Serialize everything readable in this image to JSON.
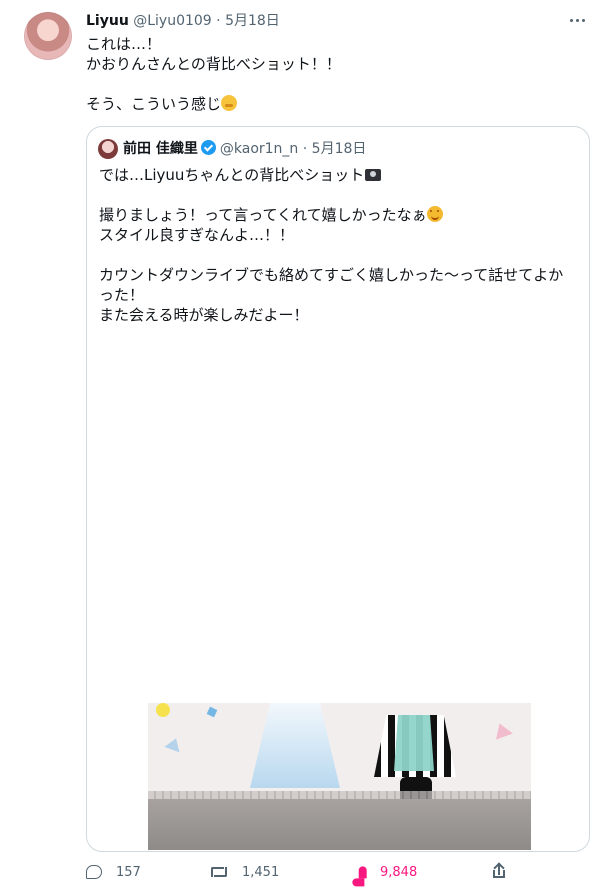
{
  "tweet": {
    "author_name": "Liyuu",
    "author_handle": "@Liyu0109",
    "date": "5月18日",
    "text_line1": "これは…！",
    "text_line2": "かおりんさんとの背比べショット！！",
    "text_line3": "そう、こういう感じ"
  },
  "quote": {
    "author_name": "前田 佳織里",
    "author_handle": "@kaor1n_n",
    "date": "5月18日",
    "text_line1": "では…Liyuuちゃんとの背比べショット",
    "text_line2": "撮りましょう！って言ってくれて嬉しかったなぁ",
    "text_line3": "スタイル良すぎなんよ…！！",
    "text_line4": "カウントダウンライブでも絡めてすごく嬉しかった〜って話せてよかった！",
    "text_line5": "また会える時が楽しみだよー！"
  },
  "actions": {
    "reply_count": "157",
    "retweet_count": "1,451",
    "like_count": "9,848"
  },
  "icons": {
    "reply": "reply-icon",
    "retweet": "retweet-icon",
    "like": "heart-icon",
    "share": "share-icon",
    "more": "more-icon",
    "verified": "verified-badge-icon"
  },
  "colors": {
    "like": "#f91880",
    "verified": "#1d9bf0",
    "muted": "#536471",
    "border": "#cfd9de"
  }
}
